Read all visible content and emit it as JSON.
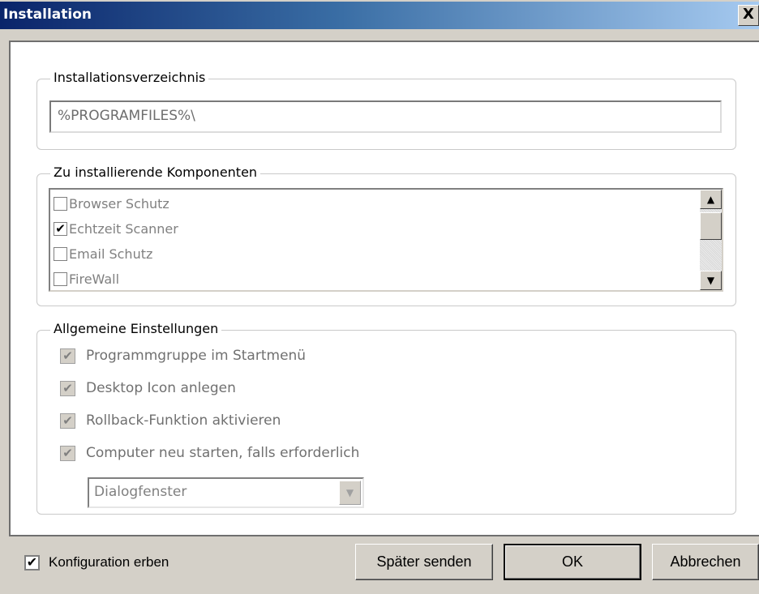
{
  "window": {
    "title": "Installation",
    "close_glyph": "X"
  },
  "install_dir": {
    "legend": "Installationsverzeichnis",
    "value": "%PROGRAMFILES%\\"
  },
  "components": {
    "legend": "Zu installierende Komponenten",
    "items": [
      {
        "label": "Browser Schutz",
        "checked": false
      },
      {
        "label": "Echtzeit Scanner",
        "checked": true
      },
      {
        "label": "Email Schutz",
        "checked": false
      },
      {
        "label": "FireWall",
        "checked": false
      }
    ],
    "scroll_up_glyph": "▲",
    "scroll_down_glyph": "▼"
  },
  "general": {
    "legend": "Allgemeine Einstellungen",
    "options": [
      {
        "label": "Programmgruppe im Startmenü",
        "checked": true
      },
      {
        "label": "Desktop Icon anlegen",
        "checked": true
      },
      {
        "label": "Rollback-Funktion aktivieren",
        "checked": true
      },
      {
        "label": "Computer neu starten, falls erforderlich",
        "checked": true
      }
    ],
    "restart_mode": {
      "value": "Dialogfenster",
      "arrow_glyph": "▼"
    }
  },
  "footer": {
    "inherit_label": "Konfiguration erben",
    "inherit_checked": true,
    "send_later_label": "Später senden",
    "ok_label": "OK",
    "cancel_label": "Abbrechen"
  },
  "check_glyph": "✔",
  "colors": {
    "titlebar_start": "#0a246a",
    "titlebar_end": "#a6caf0",
    "dialog_bg": "#d4d0c8",
    "disabled_text": "#808080"
  }
}
